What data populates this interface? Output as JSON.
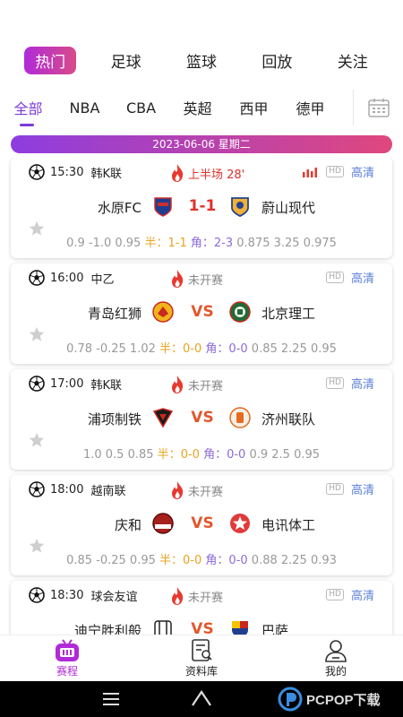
{
  "top_tabs": [
    {
      "label": "热门",
      "active": true
    },
    {
      "label": "足球",
      "active": false
    },
    {
      "label": "篮球",
      "active": false
    },
    {
      "label": "回放",
      "active": false
    },
    {
      "label": "关注",
      "active": false
    }
  ],
  "sub_tabs": [
    {
      "label": "全部",
      "active": true
    },
    {
      "label": "NBA",
      "active": false
    },
    {
      "label": "CBA",
      "active": false
    },
    {
      "label": "英超",
      "active": false
    },
    {
      "label": "西甲",
      "active": false
    },
    {
      "label": "德甲",
      "active": false
    }
  ],
  "date_label": "2023-06-06 星期二",
  "matches": [
    {
      "time": "15:30",
      "league": "韩K联",
      "status": "上半场 28'",
      "live": true,
      "hd_badge": "HD",
      "hd": "高清",
      "home": "水原FC",
      "away": "蔚山现代",
      "score": "1-1",
      "odds_left": "0.9 -1.0 0.95",
      "half_label": "半：",
      "half_score": "1-1",
      "corner_label": "角：",
      "corner_score": "2-3",
      "odds_right": "0.875 3.25 0.975"
    },
    {
      "time": "16:00",
      "league": "中乙",
      "status": "未开赛",
      "live": false,
      "hd_badge": "HD",
      "hd": "高清",
      "home": "青岛红狮",
      "away": "北京理工",
      "score": "VS",
      "odds_left": "0.78 -0.25 1.02",
      "half_label": "半：",
      "half_score": "0-0",
      "corner_label": "角：",
      "corner_score": "0-0",
      "odds_right": "0.85 2.25 0.95"
    },
    {
      "time": "17:00",
      "league": "韩K联",
      "status": "未开赛",
      "live": false,
      "hd_badge": "HD",
      "hd": "高清",
      "home": "浦项制铁",
      "away": "济州联队",
      "score": "VS",
      "odds_left": "1.0 0.5 0.85",
      "half_label": "半：",
      "half_score": "0-0",
      "corner_label": "角：",
      "corner_score": "0-0",
      "odds_right": "0.9 2.5 0.95"
    },
    {
      "time": "18:00",
      "league": "越南联",
      "status": "未开赛",
      "live": false,
      "hd_badge": "HD",
      "hd": "高清",
      "home": "庆和",
      "away": "电讯体工",
      "score": "VS",
      "odds_left": "0.85 -0.25 0.95",
      "half_label": "半：",
      "half_score": "0-0",
      "corner_label": "角：",
      "corner_score": "0-0",
      "odds_right": "0.88 2.25 0.93"
    },
    {
      "time": "18:30",
      "league": "球会友谊",
      "status": "未开赛",
      "live": false,
      "hd_badge": "HD",
      "hd": "高清",
      "home": "迪宁胜利般",
      "away": "巴萨",
      "score": "VS",
      "odds_left": "",
      "half_label": "",
      "half_score": "",
      "corner_label": "",
      "corner_score": "",
      "odds_right": ""
    }
  ],
  "bottom_nav": [
    {
      "label": "赛程",
      "active": true
    },
    {
      "label": "资料库",
      "active": false
    },
    {
      "label": "我的",
      "active": false
    }
  ],
  "watermark": "PCPOP下载",
  "colors": {
    "accent": "#b02bd8",
    "live": "#e0312b",
    "half": "#e9a321",
    "corner": "#8d6ad8",
    "hd": "#5b7fd6"
  }
}
